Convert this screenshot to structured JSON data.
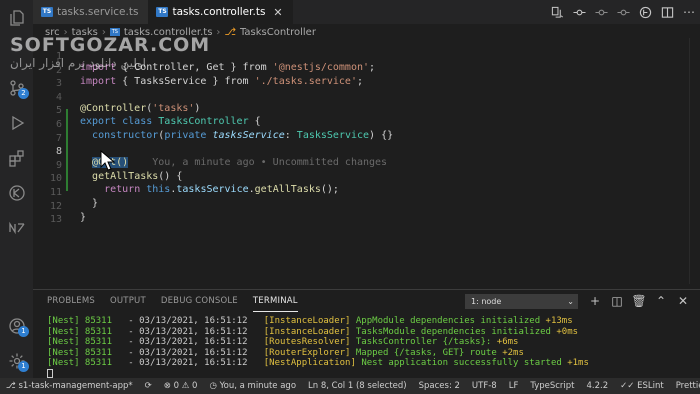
{
  "activity_bar": {
    "items": [
      {
        "name": "explorer-icon"
      },
      {
        "name": "source-control-icon",
        "badge": "2"
      },
      {
        "name": "run-debug-icon"
      },
      {
        "name": "extensions-icon"
      },
      {
        "name": "git-graph-icon"
      },
      {
        "name": "nest-icon"
      }
    ],
    "bottom": [
      {
        "name": "accounts-icon",
        "badge": "1"
      },
      {
        "name": "settings-icon",
        "badge": "1"
      }
    ]
  },
  "tabs": [
    {
      "label": "tasks.service.ts",
      "active": false
    },
    {
      "label": "tasks.controller.ts",
      "active": true
    }
  ],
  "breadcrumb": {
    "parts": [
      "src",
      "tasks",
      "tasks.controller.ts",
      "TasksController"
    ]
  },
  "watermark": {
    "title": "SOFTGOZAR.COM",
    "subtitle": "اولین دانلود نرم افزار ایران"
  },
  "editor": {
    "line_numbers": [
      "1",
      "2",
      "3",
      "4",
      "5",
      "6",
      "7",
      "8",
      "9",
      "10",
      "11",
      "12",
      "13"
    ],
    "current_line": "8",
    "blame": "You, a minute ago • Uncommitted changes",
    "code": {
      "l1_import": "import",
      "l1_rest": " { Controller, Get } from ",
      "l1_str": "'@nestjs/common'",
      "l2_import": "import",
      "l2_rest": " { TasksService } from ",
      "l2_str": "'./tasks.service'",
      "l4_dec": "@Controller",
      "l4_str": "'tasks'",
      "l5_export": "export class",
      "l5_cls": "TasksController",
      "l6_ctor": "constructor",
      "l6_private": "private",
      "l6_param": "tasksService",
      "l6_type": "TasksService",
      "l8_dec": "@Get()",
      "l9_fn": "getAllTasks",
      "l10_return": "return",
      "l10_this": "this",
      "l10_prop": "tasksService",
      "l10_call": "getAllTasks"
    }
  },
  "panel": {
    "tabs": [
      "PROBLEMS",
      "OUTPUT",
      "DEBUG CONSOLE",
      "TERMINAL"
    ],
    "active_tab": "TERMINAL",
    "terminal_select": "1: node",
    "terminal_lines": [
      {
        "prefix": "[Nest] 85311",
        "date": "   - 03/13/2021, 16:51:12",
        "ctx": "[InstanceLoader]",
        "msg": "AppModule dependencies initialized",
        "time": "+13ms"
      },
      {
        "prefix": "[Nest] 85311",
        "date": "   - 03/13/2021, 16:51:12",
        "ctx": "[InstanceLoader]",
        "msg": "TasksModule dependencies initialized",
        "time": "+0ms"
      },
      {
        "prefix": "[Nest] 85311",
        "date": "   - 03/13/2021, 16:51:12",
        "ctx": "[RoutesResolver]",
        "msg": "TasksController {/tasks}:",
        "time": "+6ms"
      },
      {
        "prefix": "[Nest] 85311",
        "date": "   - 03/13/2021, 16:51:12",
        "ctx": "[RouterExplorer]",
        "msg": "Mapped {/tasks, GET} route",
        "time": "+2ms"
      },
      {
        "prefix": "[Nest] 85311",
        "date": "   - 03/13/2021, 16:51:12",
        "ctx": "[NestApplication]",
        "msg": "Nest application successfully started",
        "time": "+1ms"
      }
    ]
  },
  "status_bar": {
    "branch": "s1-task-management-app*",
    "errors": "0",
    "warnings": "0",
    "blame": "You, a minute ago",
    "position": "Ln 8, Col 1 (8 selected)",
    "spaces": "Spaces: 2",
    "encoding": "UTF-8",
    "eol": "LF",
    "language": "TypeScript",
    "ts_version": "4.2.2",
    "eslint": "ESLint",
    "prettier": "Prettier"
  },
  "colors": {
    "accent": "#2f7fd1",
    "terminal_green": "#6ccd45",
    "terminal_yellow": "#e0c040",
    "terminal_orange": "#e6664a"
  }
}
